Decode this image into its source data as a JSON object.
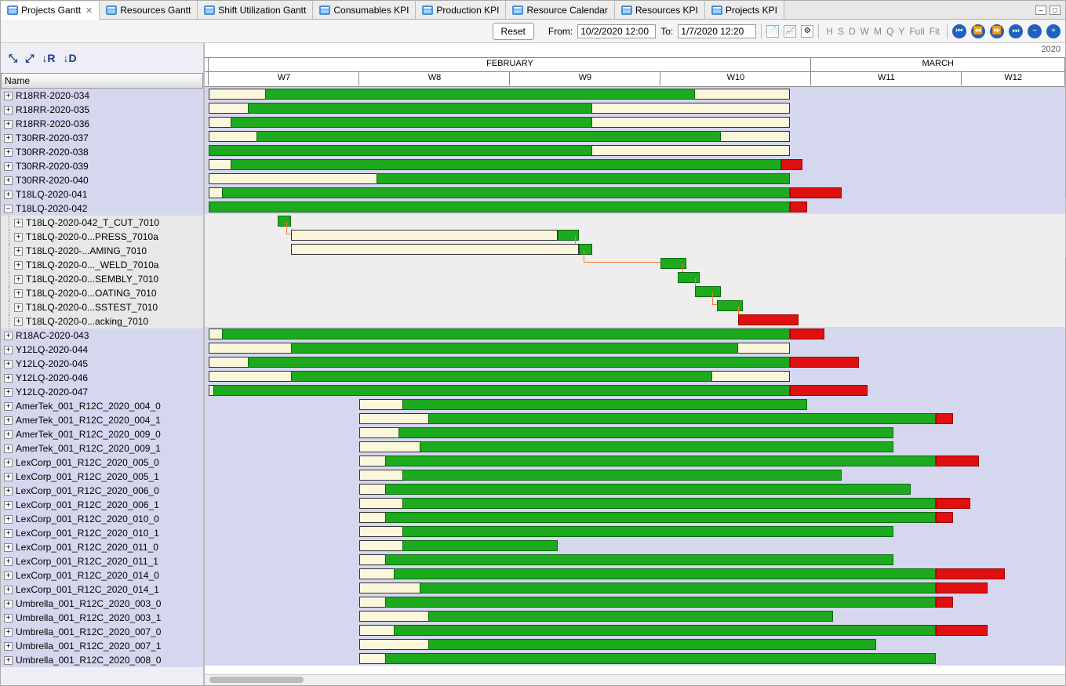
{
  "tabs": [
    {
      "label": "Projects Gantt",
      "active": true,
      "closable": true
    },
    {
      "label": "Resources Gantt"
    },
    {
      "label": "Shift Utilization Gantt"
    },
    {
      "label": "Consumables KPI"
    },
    {
      "label": "Production KPI"
    },
    {
      "label": "Resource Calendar"
    },
    {
      "label": "Resources KPI"
    },
    {
      "label": "Projects KPI"
    }
  ],
  "toolbar": {
    "reset": "Reset",
    "from_label": "From:",
    "from_value": "10/2/2020 12:00",
    "to_label": "To:",
    "to_value": "1/7/2020 12:20",
    "zoom": [
      "H",
      "S",
      "D",
      "W",
      "M",
      "Q",
      "Y",
      "Full",
      "Fit"
    ]
  },
  "year": "2020",
  "months": [
    {
      "label": "",
      "width": 0.5
    },
    {
      "label": "FEBRUARY",
      "width": 70
    },
    {
      "label": "MARCH",
      "width": 29.5
    }
  ],
  "weeks": [
    {
      "label": "",
      "width": 0.5
    },
    {
      "label": "W7",
      "width": 17.5
    },
    {
      "label": "W8",
      "width": 17.5
    },
    {
      "label": "W9",
      "width": 17.5
    },
    {
      "label": "W10",
      "width": 17.5
    },
    {
      "label": "W11",
      "width": 17.5
    },
    {
      "label": "W12",
      "width": 12
    }
  ],
  "tree_header": "Name",
  "rows": [
    {
      "name": "R18RR-2020-034",
      "lvl": 0,
      "exp": "+",
      "outline": [
        0.5,
        68
      ],
      "green": [
        7,
        57
      ],
      "red": null
    },
    {
      "name": "R18RR-2020-035",
      "lvl": 0,
      "exp": "+",
      "outline": [
        0.5,
        68
      ],
      "green": [
        5,
        45
      ],
      "red": null
    },
    {
      "name": "R18RR-2020-036",
      "lvl": 0,
      "exp": "+",
      "outline": [
        0.5,
        68
      ],
      "green": [
        3,
        45
      ],
      "red": null
    },
    {
      "name": "T30RR-2020-037",
      "lvl": 0,
      "exp": "+",
      "outline": [
        0.5,
        68
      ],
      "green": [
        6,
        60
      ],
      "red": null
    },
    {
      "name": "T30RR-2020-038",
      "lvl": 0,
      "exp": "+",
      "outline": [
        0.5,
        68
      ],
      "green": [
        0.5,
        45
      ],
      "red": null
    },
    {
      "name": "T30RR-2020-039",
      "lvl": 0,
      "exp": "+",
      "outline": [
        0.5,
        68
      ],
      "green": [
        3,
        67
      ],
      "red": [
        67,
        69.5
      ]
    },
    {
      "name": "T30RR-2020-040",
      "lvl": 0,
      "exp": "+",
      "outline": [
        0.5,
        68
      ],
      "green": [
        20,
        68
      ],
      "red": null
    },
    {
      "name": "T18LQ-2020-041",
      "lvl": 0,
      "exp": "+",
      "outline": [
        0.5,
        68
      ],
      "green": [
        2,
        68
      ],
      "red": [
        68,
        74
      ]
    },
    {
      "name": "T18LQ-2020-042",
      "lvl": 0,
      "exp": "−",
      "outline": [
        0.5,
        68
      ],
      "green": [
        0.5,
        68
      ],
      "red": [
        68,
        70
      ]
    },
    {
      "name": "T18LQ-2020-042_T_CUT_7010",
      "lvl": 1,
      "exp": "+",
      "outline": null,
      "green": [
        8.5,
        10
      ],
      "red": null
    },
    {
      "name": "T18LQ-2020-0...PRESS_7010a",
      "lvl": 1,
      "exp": "+",
      "outline": [
        10,
        41
      ],
      "green": [
        41,
        43.5
      ],
      "red": null,
      "link": [
        9.5,
        41
      ]
    },
    {
      "name": "T18LQ-2020-...AMING_7010",
      "lvl": 1,
      "exp": "+",
      "outline": [
        10,
        43.5
      ],
      "green": [
        43.5,
        45
      ],
      "red": null,
      "link": [
        43,
        44
      ]
    },
    {
      "name": "T18LQ-2020-0..._WELD_7010a",
      "lvl": 1,
      "exp": "+",
      "outline": null,
      "green": [
        53,
        56
      ],
      "red": null,
      "link": [
        44,
        53
      ]
    },
    {
      "name": "T18LQ-2020-0...SEMBLY_7010",
      "lvl": 1,
      "exp": "+",
      "outline": null,
      "green": [
        55,
        57.5
      ],
      "red": null,
      "link": [
        55.5,
        56
      ]
    },
    {
      "name": "T18LQ-2020-0...OATING_7010",
      "lvl": 1,
      "exp": "+",
      "outline": null,
      "green": [
        57,
        60
      ],
      "red": null,
      "link": [
        57,
        58
      ]
    },
    {
      "name": "T18LQ-2020-0...SSTEST_7010",
      "lvl": 1,
      "exp": "+",
      "outline": null,
      "green": [
        59.5,
        62.5
      ],
      "red": null,
      "link": [
        59,
        60
      ]
    },
    {
      "name": "T18LQ-2020-0...acking_7010",
      "lvl": 1,
      "exp": "+",
      "outline": null,
      "green": null,
      "red": [
        62,
        69
      ],
      "link": [
        62,
        62.5
      ]
    },
    {
      "name": "R18AC-2020-043",
      "lvl": 0,
      "exp": "+",
      "outline": [
        0.5,
        68
      ],
      "green": [
        2,
        68
      ],
      "red": [
        68,
        72
      ]
    },
    {
      "name": "Y12LQ-2020-044",
      "lvl": 0,
      "exp": "+",
      "outline": [
        0.5,
        68
      ],
      "green": [
        10,
        62
      ],
      "red": null
    },
    {
      "name": "Y12LQ-2020-045",
      "lvl": 0,
      "exp": "+",
      "outline": [
        0.5,
        68
      ],
      "green": [
        5,
        68
      ],
      "red": [
        68,
        76
      ]
    },
    {
      "name": "Y12LQ-2020-046",
      "lvl": 0,
      "exp": "+",
      "outline": [
        0.5,
        68
      ],
      "green": [
        10,
        59
      ],
      "red": null
    },
    {
      "name": "Y12LQ-2020-047",
      "lvl": 0,
      "exp": "+",
      "outline": [
        0.5,
        68
      ],
      "green": [
        1,
        68
      ],
      "red": [
        68,
        77
      ]
    },
    {
      "name": "AmerTek_001_R12C_2020_004_0",
      "lvl": 0,
      "exp": "+",
      "outline": [
        18,
        70
      ],
      "green": [
        23,
        70
      ],
      "red": null
    },
    {
      "name": "AmerTek_001_R12C_2020_004_1",
      "lvl": 0,
      "exp": "+",
      "outline": [
        18,
        85
      ],
      "green": [
        26,
        85
      ],
      "red": [
        85,
        87
      ]
    },
    {
      "name": "AmerTek_001_R12C_2020_009_0",
      "lvl": 0,
      "exp": "+",
      "outline": [
        18,
        80
      ],
      "green": [
        22.5,
        80
      ],
      "red": null
    },
    {
      "name": "AmerTek_001_R12C_2020_009_1",
      "lvl": 0,
      "exp": "+",
      "outline": [
        18,
        80
      ],
      "green": [
        25,
        80
      ],
      "red": null
    },
    {
      "name": "LexCorp_001_R12C_2020_005_0",
      "lvl": 0,
      "exp": "+",
      "outline": [
        18,
        85
      ],
      "green": [
        21,
        85
      ],
      "red": [
        85,
        90
      ]
    },
    {
      "name": "LexCorp_001_R12C_2020_005_1",
      "lvl": 0,
      "exp": "+",
      "outline": [
        18,
        74
      ],
      "green": [
        23,
        74
      ],
      "red": null
    },
    {
      "name": "LexCorp_001_R12C_2020_006_0",
      "lvl": 0,
      "exp": "+",
      "outline": [
        18,
        82
      ],
      "green": [
        21,
        82
      ],
      "red": null
    },
    {
      "name": "LexCorp_001_R12C_2020_006_1",
      "lvl": 0,
      "exp": "+",
      "outline": [
        18,
        85
      ],
      "green": [
        23,
        85
      ],
      "red": [
        85,
        89
      ]
    },
    {
      "name": "LexCorp_001_R12C_2020_010_0",
      "lvl": 0,
      "exp": "+",
      "outline": [
        18,
        85
      ],
      "green": [
        21,
        85
      ],
      "red": [
        85,
        87
      ]
    },
    {
      "name": "LexCorp_001_R12C_2020_010_1",
      "lvl": 0,
      "exp": "+",
      "outline": [
        18,
        80
      ],
      "green": [
        23,
        80
      ],
      "red": null
    },
    {
      "name": "LexCorp_001_R12C_2020_011_0",
      "lvl": 0,
      "exp": "+",
      "outline": [
        18,
        41
      ],
      "green": [
        23,
        41
      ],
      "red": null
    },
    {
      "name": "LexCorp_001_R12C_2020_011_1",
      "lvl": 0,
      "exp": "+",
      "outline": [
        18,
        80
      ],
      "green": [
        21,
        80
      ],
      "red": null
    },
    {
      "name": "LexCorp_001_R12C_2020_014_0",
      "lvl": 0,
      "exp": "+",
      "outline": [
        18,
        85
      ],
      "green": [
        22,
        85
      ],
      "red": [
        85,
        93
      ]
    },
    {
      "name": "LexCorp_001_R12C_2020_014_1",
      "lvl": 0,
      "exp": "+",
      "outline": [
        18,
        85
      ],
      "green": [
        25,
        85
      ],
      "red": [
        85,
        91
      ]
    },
    {
      "name": "Umbrella_001_R12C_2020_003_0",
      "lvl": 0,
      "exp": "+",
      "outline": [
        18,
        85
      ],
      "green": [
        21,
        85
      ],
      "red": [
        85,
        87
      ]
    },
    {
      "name": "Umbrella_001_R12C_2020_003_1",
      "lvl": 0,
      "exp": "+",
      "outline": [
        18,
        73
      ],
      "green": [
        26,
        73
      ],
      "red": null
    },
    {
      "name": "Umbrella_001_R12C_2020_007_0",
      "lvl": 0,
      "exp": "+",
      "outline": [
        18,
        85
      ],
      "green": [
        22,
        85
      ],
      "red": [
        85,
        91
      ]
    },
    {
      "name": "Umbrella_001_R12C_2020_007_1",
      "lvl": 0,
      "exp": "+",
      "outline": [
        18,
        78
      ],
      "green": [
        26,
        78
      ],
      "red": null
    },
    {
      "name": "Umbrella_001_R12C_2020_008_0",
      "lvl": 0,
      "exp": "+",
      "outline": [
        18,
        85
      ],
      "green": [
        21,
        85
      ],
      "red": null
    }
  ]
}
